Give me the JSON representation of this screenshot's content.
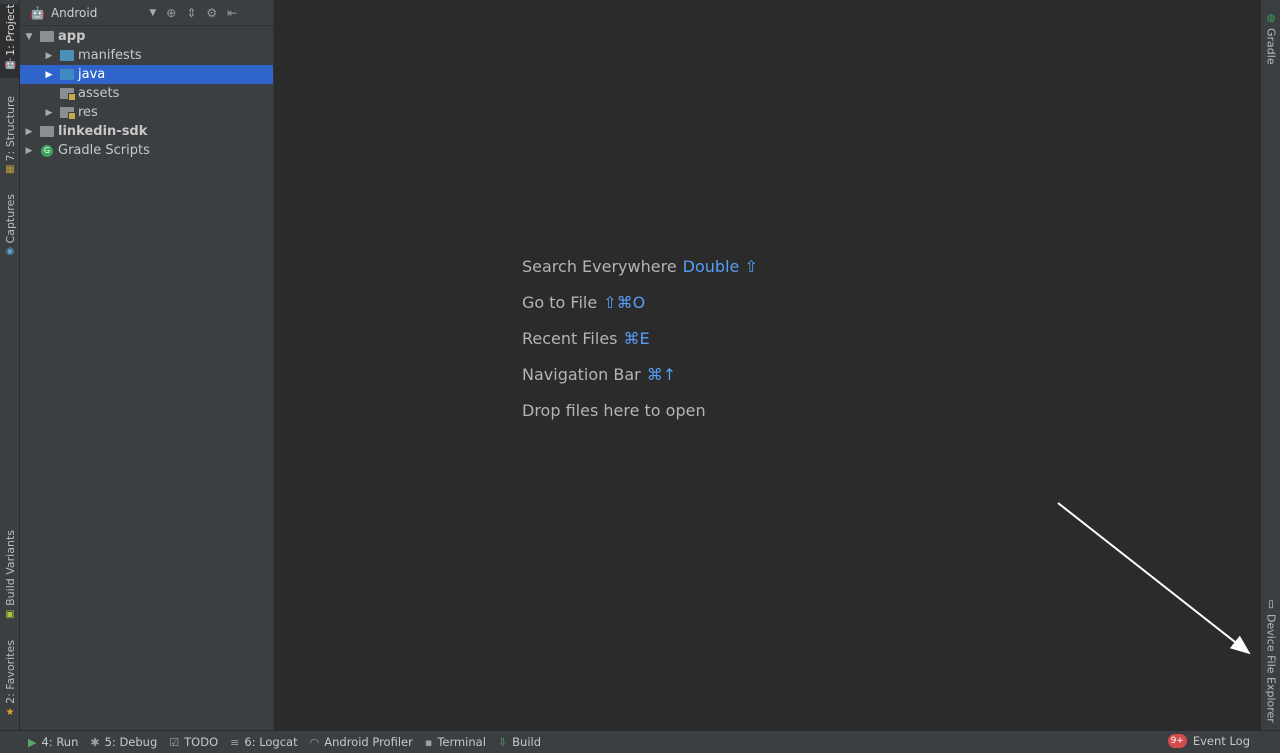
{
  "left_tabs": {
    "project": "1: Project",
    "structure": "7: Structure",
    "captures": "Captures",
    "build_variants": "Build Variants",
    "favorites": "2: Favorites"
  },
  "right_tabs": {
    "gradle": "Gradle",
    "device_file_explorer": "Device File Explorer"
  },
  "panel": {
    "view_mode": "Android"
  },
  "tree": {
    "app": "app",
    "manifests": "manifests",
    "java": "java",
    "assets": "assets",
    "res": "res",
    "linkedin_sdk": "linkedin-sdk",
    "gradle_scripts": "Gradle Scripts"
  },
  "hints": {
    "search_label": "Search Everywhere",
    "search_key": "Double ⇧",
    "goto_label": "Go to File",
    "goto_key": "⇧⌘O",
    "recent_label": "Recent Files",
    "recent_key": "⌘E",
    "nav_label": "Navigation Bar",
    "nav_key": "⌘↑",
    "drop_label": "Drop files here to open"
  },
  "bottom": {
    "run": "4: Run",
    "debug": "5: Debug",
    "todo": "TODO",
    "logcat": "6: Logcat",
    "profiler": "Android Profiler",
    "terminal": "Terminal",
    "build": "Build",
    "event_badge": "9+",
    "event_log": "Event Log"
  },
  "colors": {
    "accent": "#2f65ca",
    "hint_key": "#589df6",
    "android_green": "#a4c639"
  }
}
